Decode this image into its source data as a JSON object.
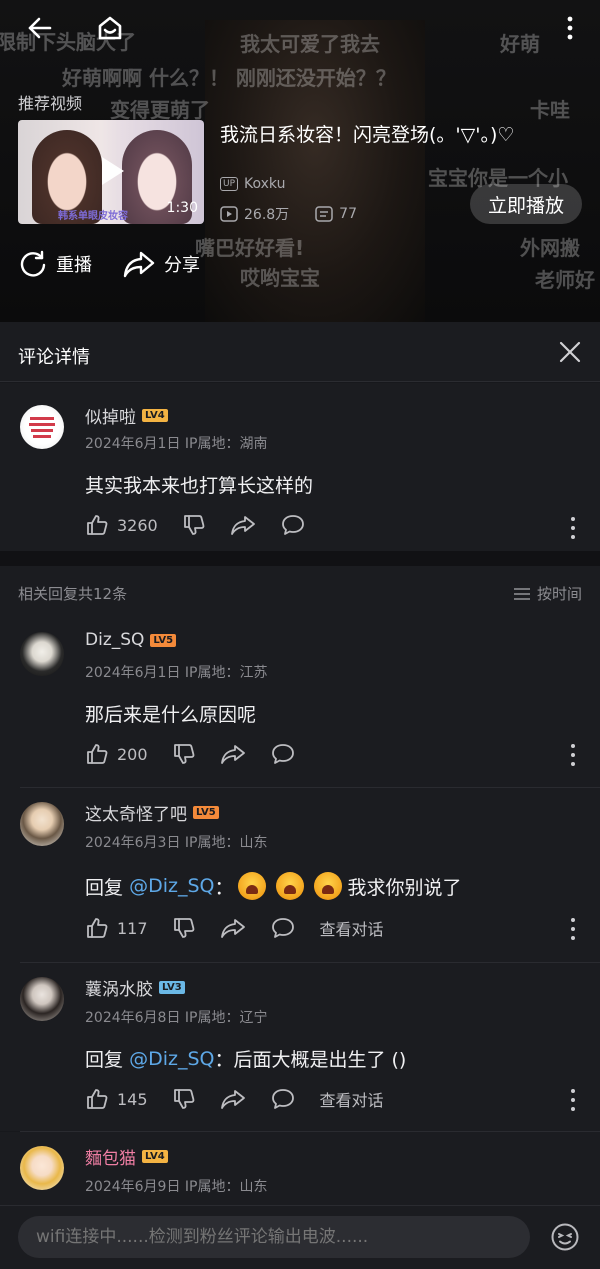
{
  "video": {
    "danmaku": [
      "限制下头脑大了",
      "我太可爱了我去",
      "好萌",
      "好萌啊啊 什么？！ 刚刚还没开始？？",
      "变得更萌了",
      "卡哇",
      "宝宝你是一个小",
      "嘴巴好好看!",
      "外网搬",
      "哎哟宝宝",
      "老师好"
    ],
    "recommend_label": "推荐视频",
    "thumb_caption": "韩系单眼皮妆容",
    "duration": "1:30",
    "title": "我流日系妆容！闪亮登场(。'▽'。)♡",
    "uploader_badge": "UP",
    "uploader": "Koxku",
    "views": "26.8万",
    "danmaku_count": "77",
    "play_now": "立即播放",
    "replay": "重播",
    "share": "分享"
  },
  "panel": {
    "title": "评论详情"
  },
  "main_comment": {
    "user": "似掉啦",
    "level": "LV4",
    "date": "2024年6月1日",
    "ip": "IP属地：湖南",
    "text": "其实我本来也打算长这样的",
    "likes": "3260"
  },
  "replies_header": {
    "count": "相关回复共12条",
    "sort": "按时间"
  },
  "replies": [
    {
      "user": "Diz_SQ",
      "level": "LV5",
      "date": "2024年6月1日",
      "ip": "IP属地：江苏",
      "text": "那后来是什么原因呢",
      "likes": "200"
    },
    {
      "user": "这太奇怪了吧",
      "level": "LV5",
      "date": "2024年6月3日",
      "ip": "IP属地：山东",
      "reply_prefix": "回复",
      "mention": "@Diz_SQ",
      "colon": "：",
      "text": "我求你别说了",
      "likes": "117",
      "view_convo": "查看对话"
    },
    {
      "user": "蘘涡水胶",
      "level": "LV3",
      "date": "2024年6月8日",
      "ip": "IP属地：辽宁",
      "reply_prefix": "回复",
      "mention": "@Diz_SQ",
      "colon": "：",
      "text": "后面大概是出生了 ()",
      "likes": "145",
      "view_convo": "查看对话"
    },
    {
      "user": "麵包猫",
      "level": "LV4",
      "date": "2024年6月9日",
      "ip": "IP属地：山东"
    }
  ],
  "bottom": {
    "placeholder": "wifi连接中......检测到粉丝评论输出电波......"
  },
  "colors": {
    "background": "#17181c",
    "panel": "#1b1c20",
    "mention": "#5ea8e7",
    "pink_name": "#ef7ea3"
  }
}
